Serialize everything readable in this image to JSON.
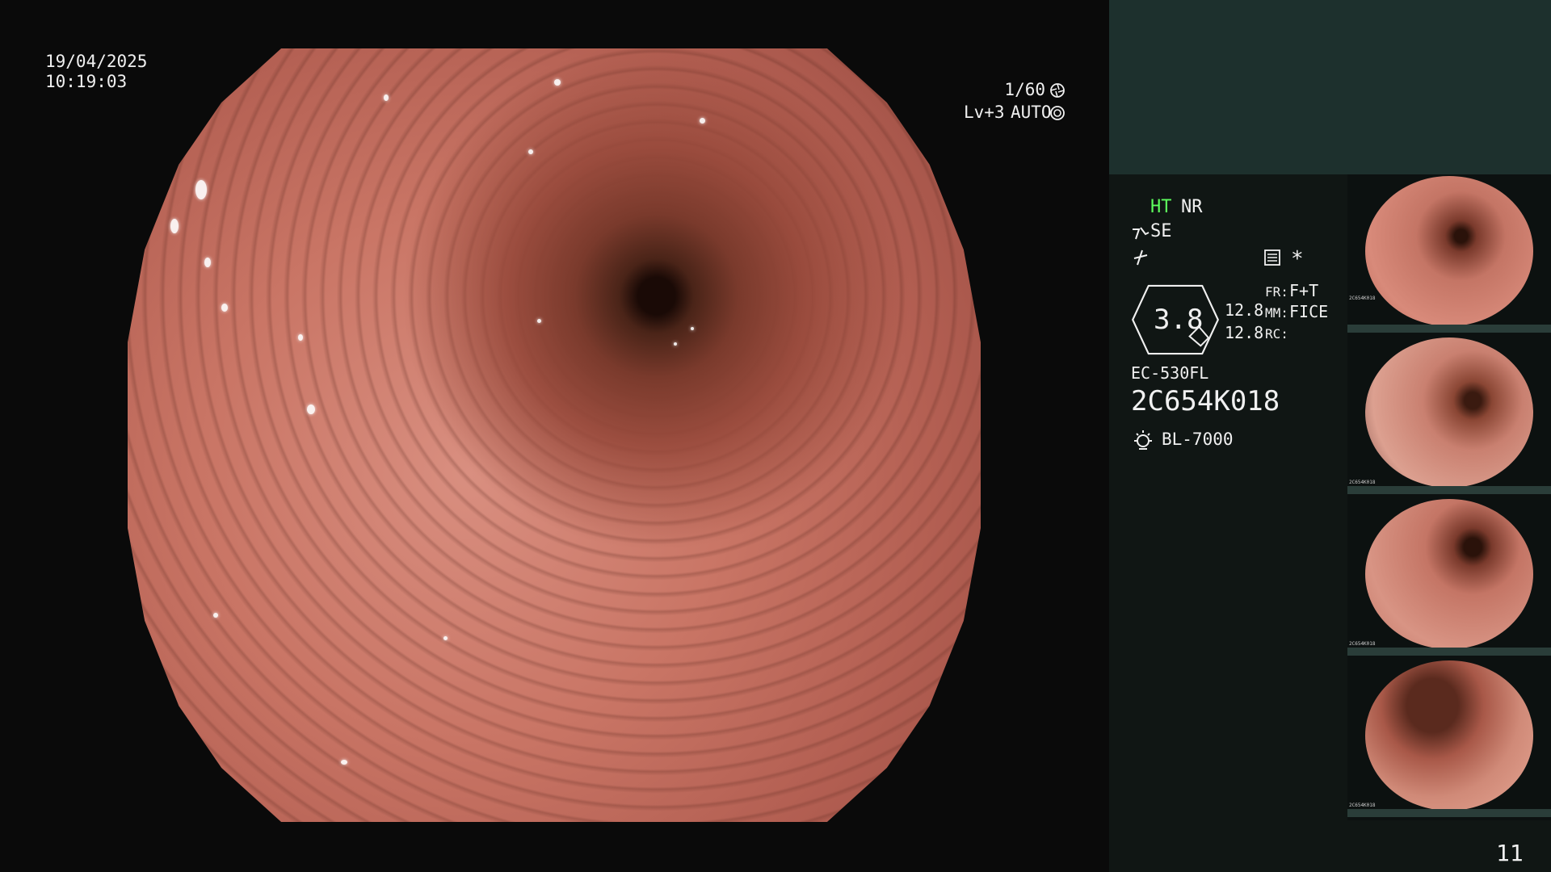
{
  "overlay": {
    "date": "19/04/2025",
    "time": "10:19:03",
    "shutter": "1/60",
    "level": "Lv+3",
    "auto": "AUTO"
  },
  "panel": {
    "ht": "HT",
    "nr": "NR",
    "se": "SE",
    "dial_value": "3.8",
    "val1": "12.8",
    "val2": "12.8",
    "fr_label": "FR:",
    "fr_value": "F+T",
    "mm_label": "MM:",
    "mm_value": "FICE",
    "rc_label": "RC:",
    "scope_model": "EC-530FL",
    "scope_serial": "2C654K018",
    "light_source": "BL-7000",
    "star": "*",
    "image_count": "11"
  },
  "icons": {
    "shutter": "aperture-icon",
    "auto": "iris-icon",
    "enhance": "enhance-icon",
    "structure": "structure-icon",
    "settings": "settings-icon",
    "light": "lamp-icon"
  },
  "thumbnails": [
    {
      "serial": "2C654K018"
    },
    {
      "serial": "2C654K018"
    },
    {
      "serial": "2C654K018"
    },
    {
      "serial": "2C654K018"
    }
  ],
  "colors": {
    "ht_green": "#5dff5d",
    "panel_top": "#1d302d",
    "panel_bg": "#101614"
  }
}
